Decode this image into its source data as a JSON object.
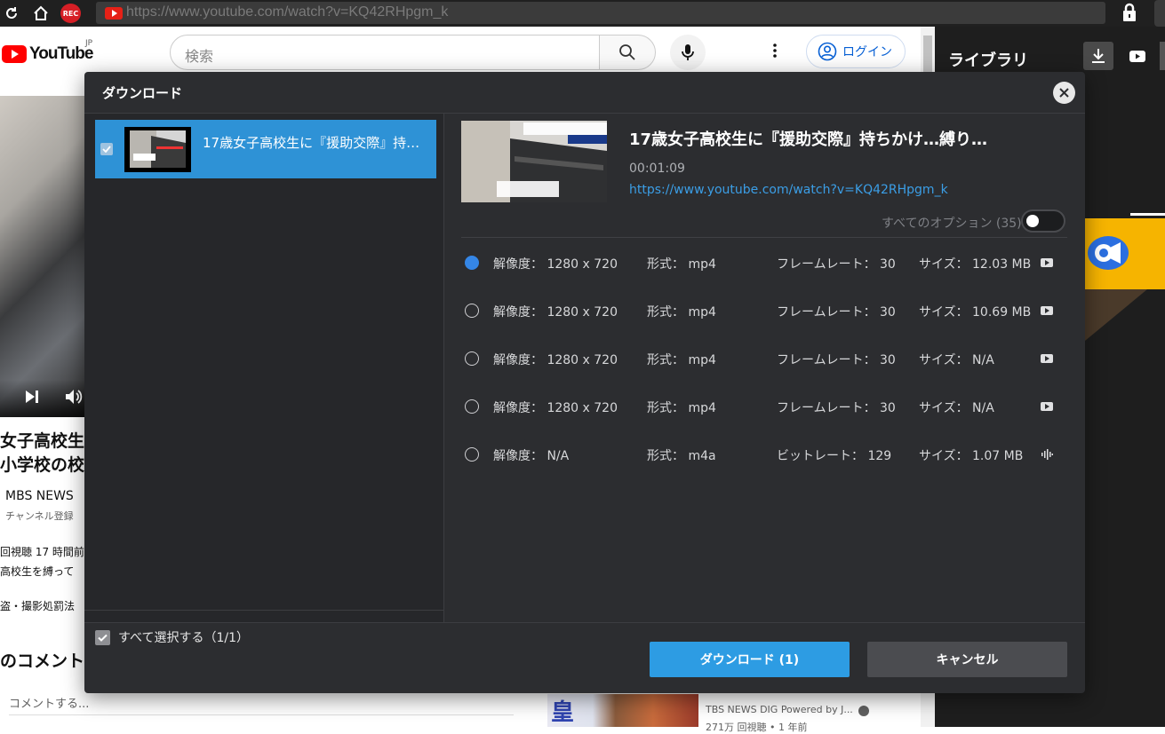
{
  "browser": {
    "rec_badge": "REC",
    "url": "https://www.youtube.com/watch?v=KQ42RHpgm_k"
  },
  "youtube": {
    "logo_text": "YouTube",
    "region": "JP",
    "search_placeholder": "検索",
    "login_label": "ログイン",
    "video_title_line1": "女子高校生に",
    "video_title_line2": "小学校の校",
    "channel": "MBS NEWS",
    "subscribers": "チャンネル登録",
    "desc_line1": "回視聴  17 時間前",
    "desc_line2": "高校生を縛って",
    "desc_line3": "盗・撮影処罰法",
    "comments_heading": "のコメント",
    "comment_placeholder": "コメントする...",
    "related_channel": "TBS NEWS DIG Powered by J...",
    "related_views": "271万 回視聴 • 1 年前",
    "related_thumb_text": "皇"
  },
  "library": {
    "title": "ライブラリ"
  },
  "dialog": {
    "title": "ダウンロード",
    "list_item_title": "17歳女子高校生に『援助交際』持ちかけ…縛り…",
    "select_all_label": "すべて選択する（1/1）",
    "detail": {
      "title": "17歳女子高校生に『援助交際』持ちかけ…縛り…",
      "duration": "00:01:09",
      "url": "https://www.youtube.com/watch?v=KQ42RHpgm_k",
      "options_label": "すべてのオプション (35)"
    },
    "formats": [
      {
        "resolution": "解像度：  1280 x 720",
        "format": "形式：  mp4",
        "rate": "フレームレート：  30",
        "size": "サイズ：  12.03 MB",
        "type_icon": "video-icon",
        "selected": true
      },
      {
        "resolution": "解像度：  1280 x 720",
        "format": "形式：  mp4",
        "rate": "フレームレート：  30",
        "size": "サイズ：  10.69 MB",
        "type_icon": "video-icon",
        "selected": false
      },
      {
        "resolution": "解像度：  1280 x 720",
        "format": "形式：  mp4",
        "rate": "フレームレート：  30",
        "size": "サイズ：  N/A",
        "type_icon": "video-icon",
        "selected": false
      },
      {
        "resolution": "解像度：  1280 x 720",
        "format": "形式：  mp4",
        "rate": "フレームレート：  30",
        "size": "サイズ：  N/A",
        "type_icon": "video-icon",
        "selected": false
      },
      {
        "resolution": "解像度：  N/A",
        "format": "形式：  m4a",
        "rate": "ビットレート：  129",
        "size": "サイズ：  1.07 MB",
        "type_icon": "audio-wave-icon",
        "selected": false
      }
    ],
    "download_button": "ダウンロード (1)",
    "cancel_button": "キャンセル"
  },
  "colors": {
    "accent_blue": "#2d9ce3",
    "dialog_bg": "#2c2d30",
    "radio_selected": "#3586e6",
    "link_blue": "#3b9ee6"
  }
}
